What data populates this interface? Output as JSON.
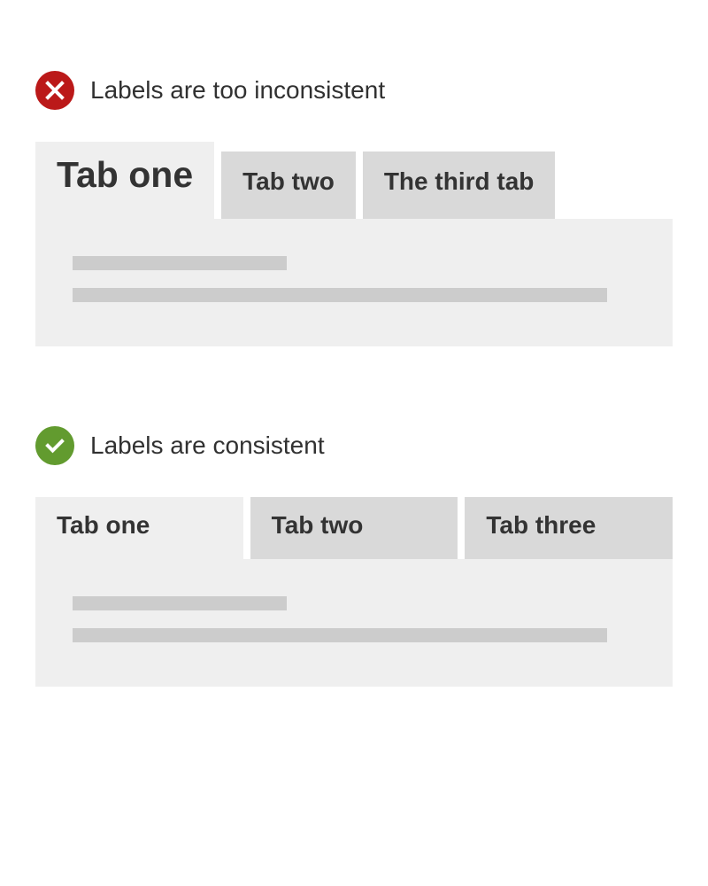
{
  "bad": {
    "caption": "Labels are too inconsistent",
    "tabs": [
      "Tab one",
      "Tab two",
      "The third tab"
    ]
  },
  "good": {
    "caption": "Labels are consistent",
    "tabs": [
      "Tab one",
      "Tab two",
      "Tab three"
    ]
  }
}
